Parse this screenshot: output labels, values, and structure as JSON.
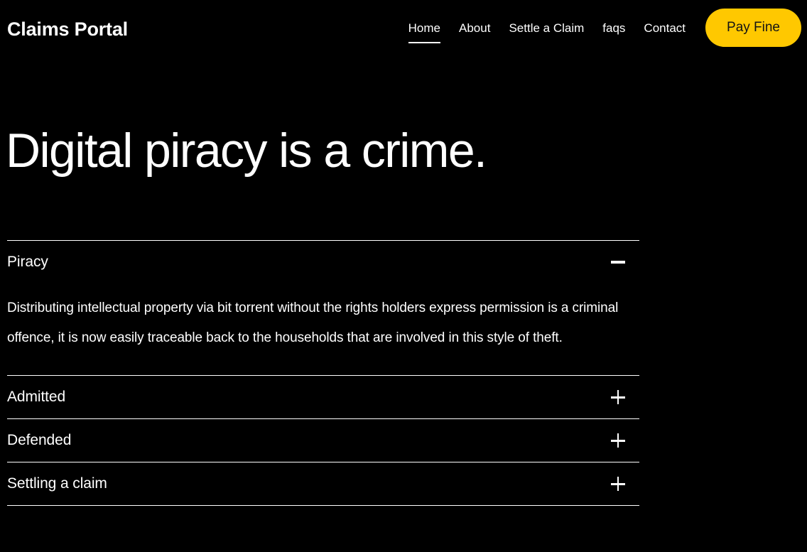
{
  "header": {
    "brand": "Claims Portal",
    "nav": [
      {
        "label": "Home",
        "active": true
      },
      {
        "label": "About",
        "active": false
      },
      {
        "label": "Settle a Claim",
        "active": false
      },
      {
        "label": "faqs",
        "active": false
      },
      {
        "label": "Contact",
        "active": false
      }
    ],
    "cta_label": "Pay Fine",
    "cta_color": "#FFC800",
    "cta_text_color": "#141414"
  },
  "hero": {
    "title": "Digital piracy is a crime."
  },
  "accordion": {
    "items": [
      {
        "label": "Piracy",
        "expanded": true,
        "icon": "minus-icon",
        "body": "Distributing intellectual property via bit torrent without the rights holders express permission is a criminal offence, it is now easily traceable back to the households that are involved in this style of theft."
      },
      {
        "label": "Admitted",
        "expanded": false,
        "icon": "plus-icon",
        "body": ""
      },
      {
        "label": "Defended",
        "expanded": false,
        "icon": "plus-icon",
        "body": ""
      },
      {
        "label": "Settling a claim",
        "expanded": false,
        "icon": "plus-icon",
        "body": ""
      }
    ]
  },
  "theme": {
    "background": "#000000",
    "text": "#FFFFFF",
    "accent": "#FFC800"
  }
}
